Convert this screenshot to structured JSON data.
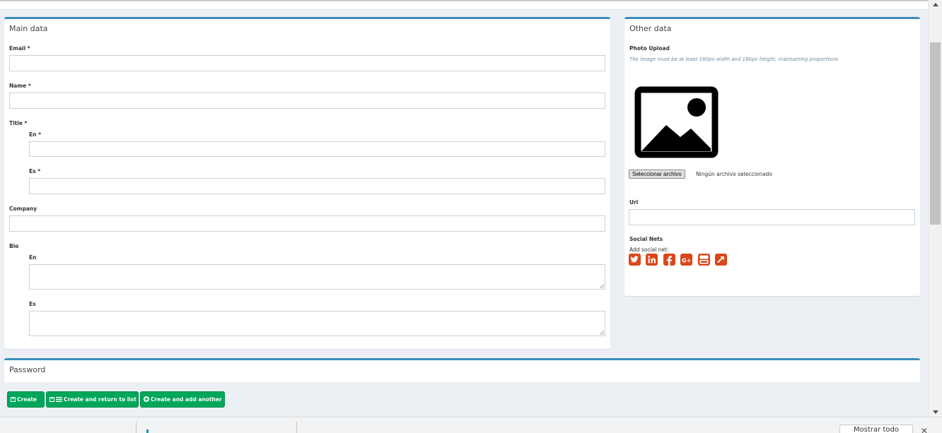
{
  "main_box": {
    "title": "Main data",
    "email_label": "Email *",
    "name_label": "Name *",
    "title_label": "Title *",
    "title_en_label": "En *",
    "title_es_label": "Es *",
    "company_label": "Company",
    "bio_label": "Bio",
    "bio_en_label": "En",
    "bio_es_label": "Es"
  },
  "other_box": {
    "title": "Other data",
    "photo_label": "Photo Upload",
    "photo_hint": "The image must be at least 160px width and 160px height, maintaining proportions",
    "file_button": "Seleccionar archivo",
    "file_status": "Ningún archivo seleccionado",
    "url_label": "Url",
    "social_label": "Social Nets",
    "add_social": "Add social net:",
    "social_icons": [
      "twitter-icon",
      "linkedin-icon",
      "facebook-icon",
      "google-plus-icon",
      "youtube-icon",
      "external-link-icon"
    ],
    "social_color": "#d9471b"
  },
  "password_box": {
    "title": "Password"
  },
  "actions": {
    "create": "Create",
    "create_return": "Create and return to list",
    "create_another": "Create and add another"
  },
  "download_bar": {
    "show_all": "Mostrar todo"
  },
  "colors": {
    "accent": "#3c8dbc",
    "button": "#00a65a",
    "background": "#ecf0f5"
  }
}
